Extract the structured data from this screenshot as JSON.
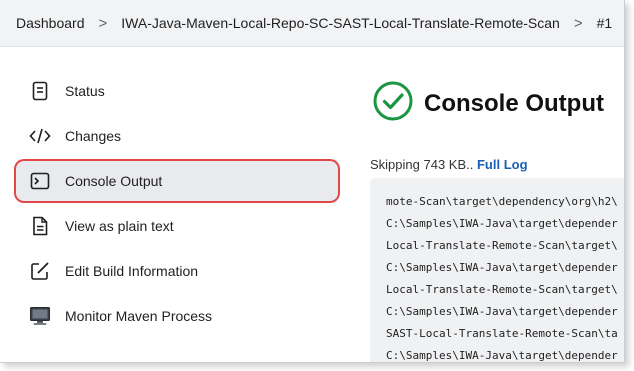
{
  "breadcrumb": {
    "items": [
      "Dashboard",
      "IWA-Java-Maven-Local-Repo-SC-SAST-Local-Translate-Remote-Scan",
      "#1"
    ],
    "separator": ">"
  },
  "sidebar": {
    "items": [
      {
        "label": "Status",
        "icon": "document-icon"
      },
      {
        "label": "Changes",
        "icon": "code-icon"
      },
      {
        "label": "Console Output",
        "icon": "terminal-icon",
        "active": true
      },
      {
        "label": "View as plain text",
        "icon": "file-text-icon"
      },
      {
        "label": "Edit Build Information",
        "icon": "edit-icon"
      },
      {
        "label": "Monitor Maven Process",
        "icon": "monitor-icon"
      }
    ]
  },
  "main": {
    "title": "Console Output",
    "skip_text": "Skipping 743 KB..",
    "full_log_label": "Full Log",
    "console_lines": [
      "mote-Scan\\target\\dependency\\org\\h2\\",
      "C:\\Samples\\IWA-Java\\target\\depender",
      "Local-Translate-Remote-Scan\\target\\",
      "C:\\Samples\\IWA-Java\\target\\depender",
      "Local-Translate-Remote-Scan\\target\\",
      "C:\\Samples\\IWA-Java\\target\\depender",
      "SAST-Local-Translate-Remote-Scan\\ta",
      "C:\\Samples\\IWA-Java\\target\\depender"
    ]
  },
  "colors": {
    "accent_green": "#1a9641",
    "highlight_red": "#e04848",
    "link_blue": "#1a5fb4"
  }
}
